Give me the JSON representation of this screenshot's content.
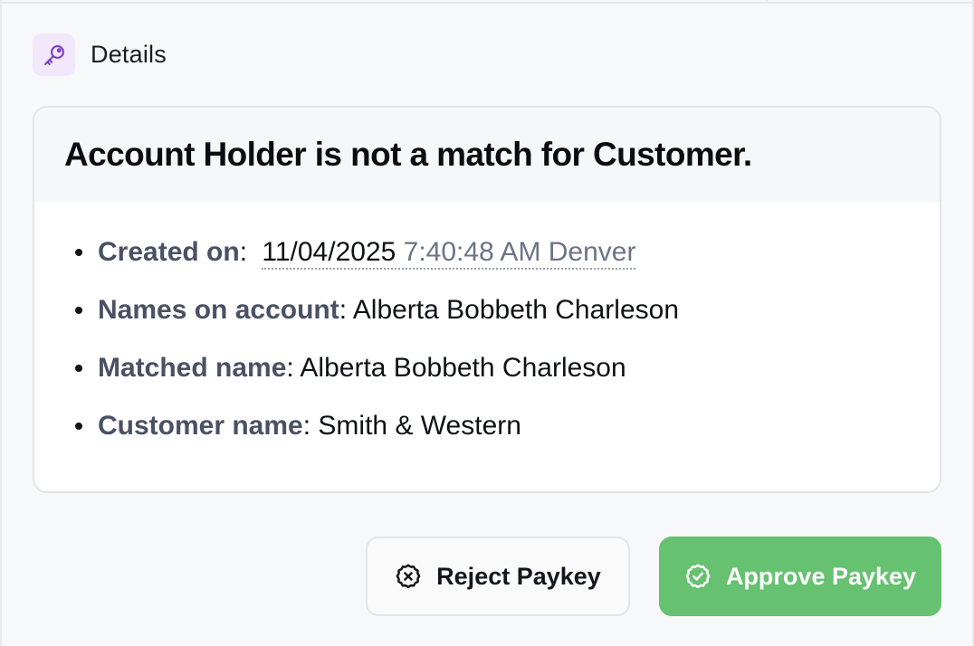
{
  "section": {
    "title": "Details",
    "icon": "key-icon",
    "icon_color": "#7b3fc4"
  },
  "card": {
    "title": "Account Holder is not a match for Customer.",
    "details": [
      {
        "label": "Created on",
        "separator": ":",
        "date": "11/04/2025",
        "time": "7:40:48 AM Denver"
      },
      {
        "label": "Names on account",
        "separator": ":",
        "value": "Alberta Bobbeth Charleson"
      },
      {
        "label": "Matched name",
        "separator": ":",
        "value": "Alberta Bobbeth Charleson"
      },
      {
        "label": "Customer name",
        "separator": ":",
        "value": "Smith & Western"
      }
    ]
  },
  "actions": {
    "reject": {
      "label": "Reject Paykey",
      "icon": "x-circle-icon"
    },
    "approve": {
      "label": "Approve Paykey",
      "icon": "check-circle-icon",
      "color": "#66c170"
    }
  }
}
